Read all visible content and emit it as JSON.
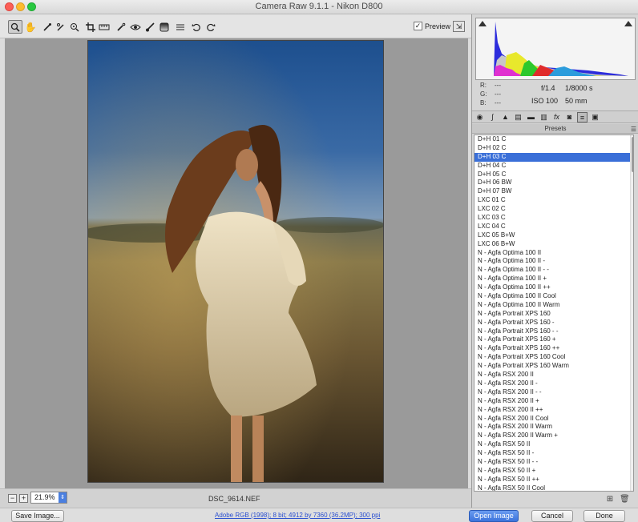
{
  "window": {
    "title": "Camera Raw 9.1.1  -  Nikon D800"
  },
  "toolbar": {
    "tools": [
      "zoom-icon",
      "hand-icon",
      "white-balance-icon",
      "color-sampler-icon",
      "targeted-adjustment-icon",
      "crop-icon",
      "straighten-icon",
      "spot-removal-icon",
      "red-eye-icon",
      "adjustment-brush-icon",
      "graduated-filter-icon",
      "radial-filter-icon",
      "preferences-icon",
      "rotate-ccw-icon",
      "rotate-cw-icon"
    ],
    "preview_label": "Preview",
    "preview_checked": true
  },
  "image": {
    "filename": "DSC_9614.NEF"
  },
  "status": {
    "zoom": "21.9%"
  },
  "info": {
    "r_label": "R:",
    "r_value": "---",
    "g_label": "G:",
    "g_value": "---",
    "b_label": "B:",
    "b_value": "---",
    "aperture": "f/1.4",
    "shutter": "1/8000 s",
    "iso": "ISO 100",
    "focal": "50 mm"
  },
  "panel": {
    "header": "Presets",
    "tabs": [
      "basic-icon",
      "tone-curve-icon",
      "detail-icon",
      "hsl-icon",
      "split-toning-icon",
      "lens-icon",
      "fx-icon",
      "camera-calibration-icon",
      "presets-icon",
      "snapshots-icon"
    ],
    "active_tab": 8,
    "selected_index": 2,
    "presets": [
      "D+H 01 C",
      "D+H 02 C",
      "D+H 03 C",
      "D+H 04 C",
      "D+H 05 C",
      "D+H 06 BW",
      "D+H 07 BW",
      "LXC 01 C",
      "LXC 02 C",
      "LXC 03 C",
      "LXC 04 C",
      "LXC 05 B+W",
      "LXC 06 B+W",
      "N - Agfa Optima 100 II",
      "N - Agfa Optima 100 II -",
      "N - Agfa Optima 100 II - -",
      "N - Agfa Optima 100 II +",
      "N - Agfa Optima 100 II ++",
      "N - Agfa Optima 100 II Cool",
      "N - Agfa Optima 100 II Warm",
      "N - Agfa Portrait XPS 160",
      "N - Agfa Portrait XPS 160 -",
      "N - Agfa Portrait XPS 160 - -",
      "N - Agfa Portrait XPS 160 +",
      "N - Agfa Portrait XPS 160 ++",
      "N - Agfa Portrait XPS 160 Cool",
      "N - Agfa Portrait XPS 160 Warm",
      "N - Agfa RSX 200 II",
      "N - Agfa RSX 200 II -",
      "N - Agfa RSX 200 II - -",
      "N - Agfa RSX 200 II +",
      "N - Agfa RSX 200 II ++",
      "N - Agfa RSX 200 II Cool",
      "N - Agfa RSX 200 II Warm",
      "N - Agfa RSX 200 II Warm +",
      "N - Agfa RSX 50 II",
      "N - Agfa RSX 50 II -",
      "N - Agfa RSX 50 II - -",
      "N - Agfa RSX 50 II +",
      "N - Agfa RSX 50 II ++",
      "N - Agfa RSX 50 II Cool"
    ]
  },
  "bottom": {
    "save_label": "Save Image...",
    "workflow": "Adobe RGB (1998); 8 bit; 4912 by 7360 (36.2MP); 300 ppi",
    "open_label": "Open Image",
    "cancel_label": "Cancel",
    "done_label": "Done"
  }
}
